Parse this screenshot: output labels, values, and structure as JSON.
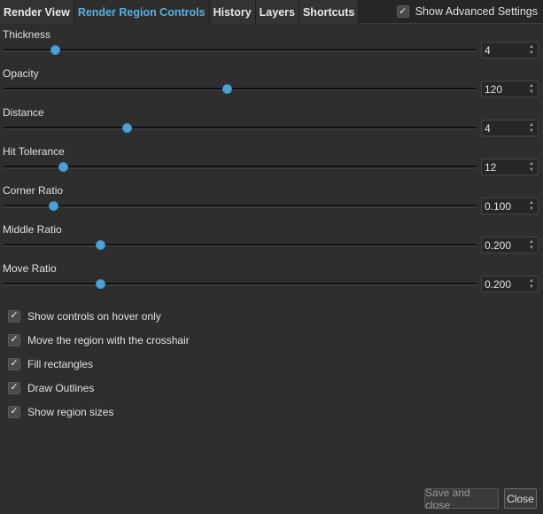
{
  "tabs": [
    {
      "label": "Render View",
      "active": false
    },
    {
      "label": "Render Region Controls",
      "active": true
    },
    {
      "label": "History",
      "active": false
    },
    {
      "label": "Layers",
      "active": false
    },
    {
      "label": "Shortcuts",
      "active": false
    }
  ],
  "advanced": {
    "label": "Show Advanced Settings",
    "checked": true
  },
  "sliders": [
    {
      "label": "Thickness",
      "value": "4",
      "fraction": 0.108
    },
    {
      "label": "Opacity",
      "value": "120",
      "fraction": 0.471
    },
    {
      "label": "Distance",
      "value": "4",
      "fraction": 0.261
    },
    {
      "label": "Hit Tolerance",
      "value": "12",
      "fraction": 0.125
    },
    {
      "label": "Corner Ratio",
      "value": "0.100",
      "fraction": 0.104
    },
    {
      "label": "Middle Ratio",
      "value": "0.200",
      "fraction": 0.204
    },
    {
      "label": "Move Ratio",
      "value": "0.200",
      "fraction": 0.204
    }
  ],
  "checkboxes": [
    {
      "label": "Show controls on hover only",
      "checked": true
    },
    {
      "label": "Move the region with the crosshair",
      "checked": true
    },
    {
      "label": "Fill rectangles",
      "checked": true
    },
    {
      "label": "Draw Outlines",
      "checked": true
    },
    {
      "label": "Show region sizes",
      "checked": true
    }
  ],
  "buttons": {
    "save_close": "Save and close",
    "close": "Close"
  },
  "icons": {
    "check": "check-icon",
    "spin_up": "arrow-up-icon",
    "spin_down": "arrow-down-icon"
  },
  "colors": {
    "accent": "#4aa3d8",
    "active_tab": "#5ab0e0",
    "background": "#2e2e2e"
  }
}
